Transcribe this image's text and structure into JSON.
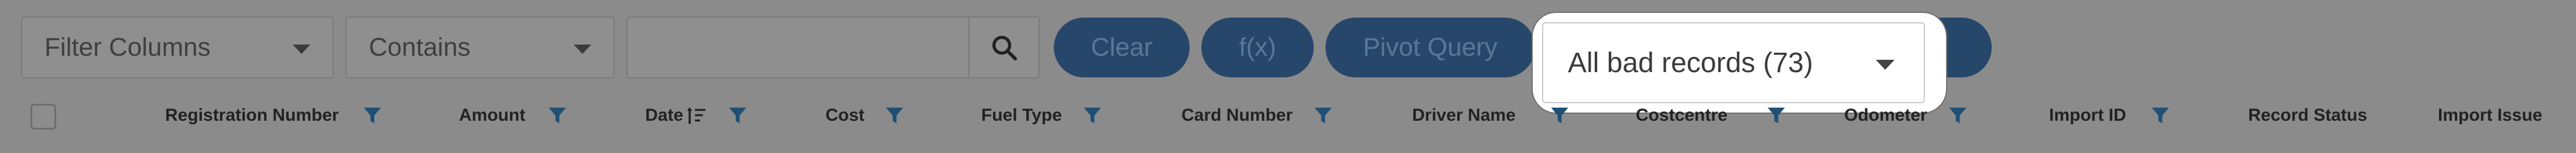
{
  "toolbar": {
    "filter_columns": "Filter Columns",
    "operator": "Contains",
    "search_value": "",
    "clear_label": "Clear",
    "fx_label": "f(x)",
    "pivot_label": "Pivot Query",
    "records_filter": "All bad records (73)"
  },
  "columns": [
    {
      "label": "Registration Number",
      "filter_icon": "filter-icon"
    },
    {
      "label": "Amount",
      "filter_icon": "filter-icon"
    },
    {
      "label": "Date",
      "sort_icon": "sort-desc-icon",
      "filter_icon": "filter-icon"
    },
    {
      "label": "Cost",
      "filter_icon": "filter-icon"
    },
    {
      "label": "Fuel Type",
      "filter_icon": "filter-icon"
    },
    {
      "label": "Card Number",
      "filter_icon": "filter-icon"
    },
    {
      "label": "Driver Name",
      "filter_icon": "filter-icon"
    },
    {
      "label": "Costcentre",
      "filter_icon": "filter-icon"
    },
    {
      "label": "Odometer",
      "filter_icon": "filter-icon"
    },
    {
      "label": "Import ID",
      "filter_icon": "filter-icon"
    },
    {
      "label": "Record Status"
    },
    {
      "label": "Import Issue"
    }
  ],
  "colors": {
    "overlay": "#8b8b8b",
    "pill": "#27476a",
    "filter_icon": "#1f4f74",
    "popup": "#ffffff"
  }
}
